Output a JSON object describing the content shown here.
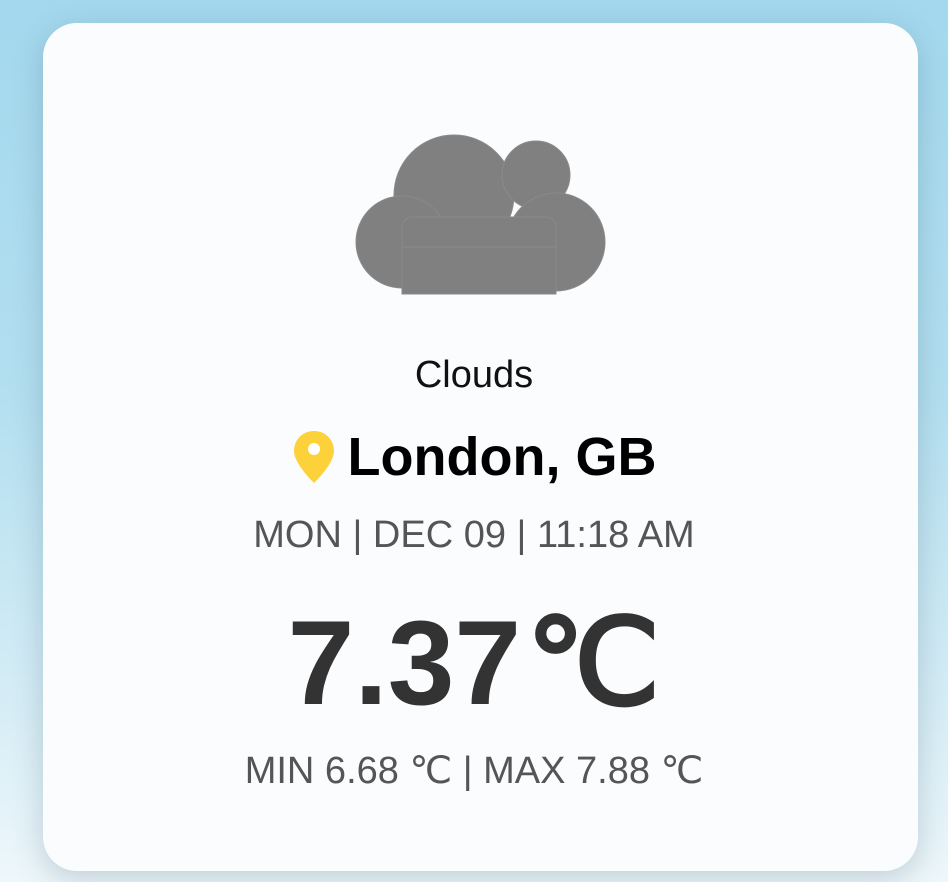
{
  "weather": {
    "icon": "cloud-icon",
    "condition": "Clouds",
    "location": "London, GB",
    "location_icon": "map-pin-icon",
    "datetime": "MON | DEC 09 | 11:18 AM",
    "temperature": "7.37",
    "temperature_unit": "℃",
    "min_label": "MIN 6.68",
    "max_label": "MAX 7.88",
    "unit": "℃",
    "separator": "|"
  },
  "colors": {
    "cloud": "#808080",
    "pin": "#fdd13a",
    "card_background": "#fbfcfe",
    "page_background": "#a3d8ee"
  }
}
